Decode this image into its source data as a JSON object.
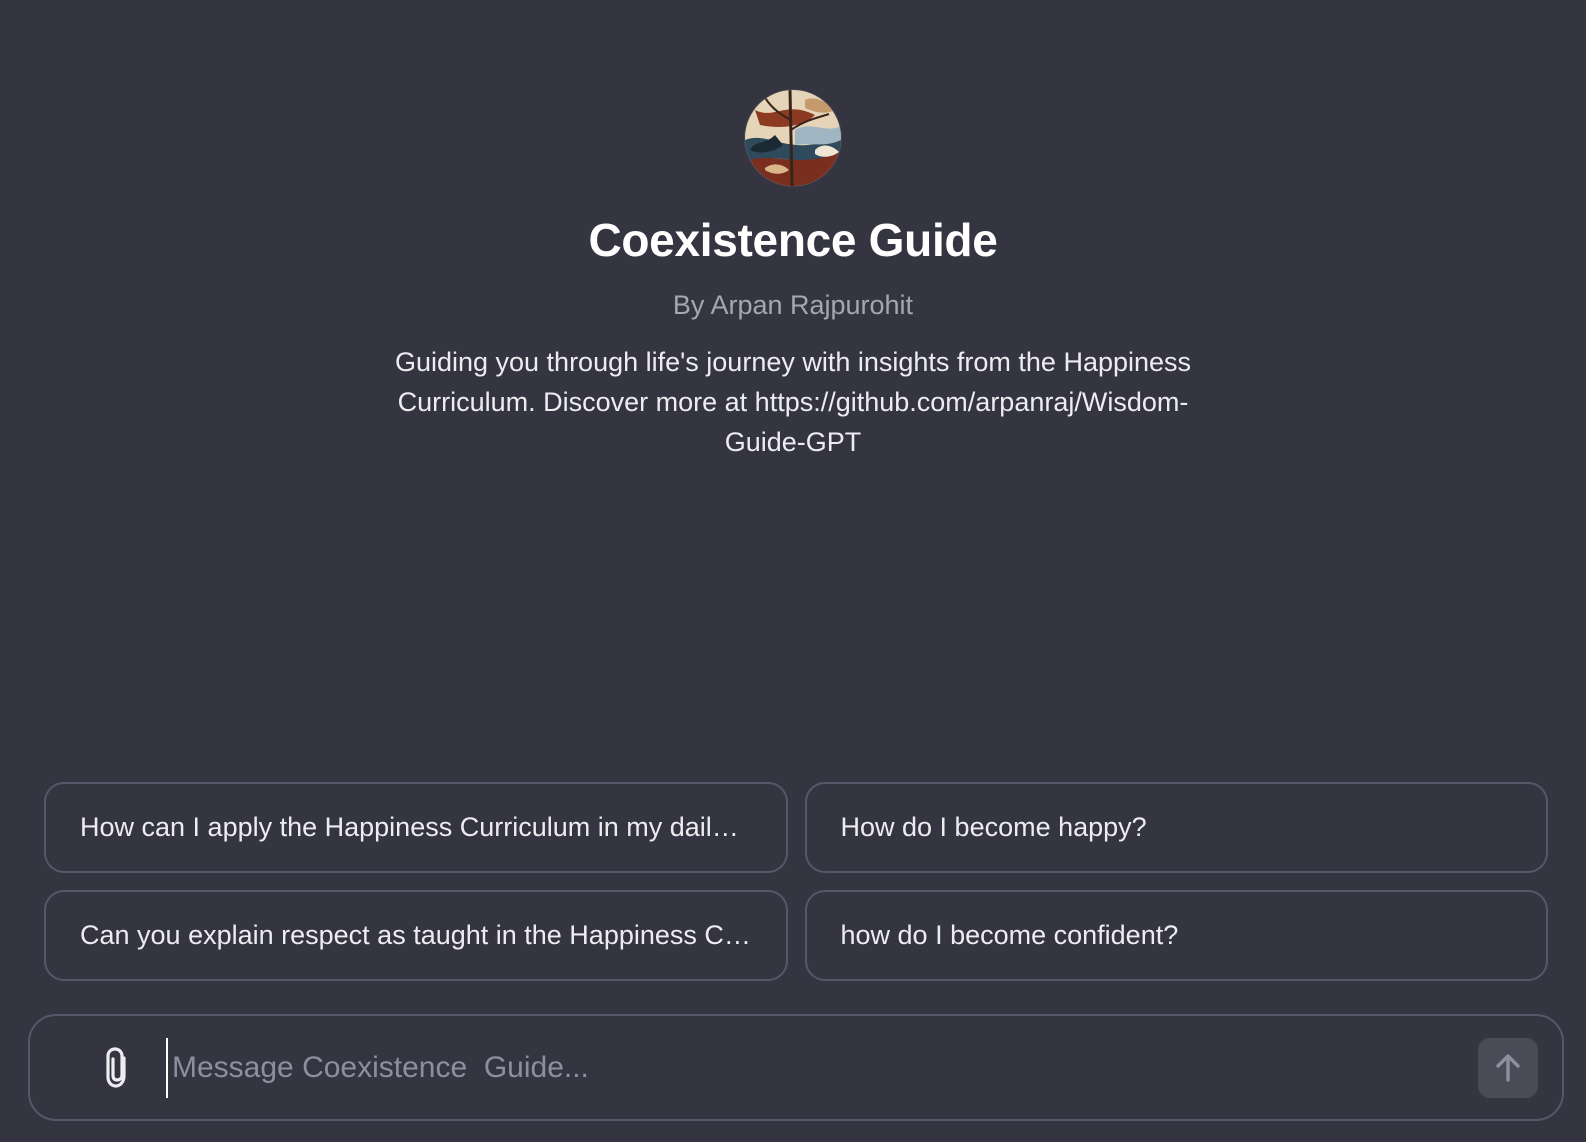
{
  "gpt": {
    "avatar_alt": "Coexistence Guide avatar",
    "title": "Coexistence Guide",
    "author": "By Arpan Rajpurohit",
    "description": "Guiding you through life's journey with insights from the Happiness Curriculum. Discover more at https://github.com/arpanraj/Wisdom-Guide-GPT"
  },
  "suggestions": [
    {
      "label": "How can I apply the Happiness Curriculum in my daily life?"
    },
    {
      "label": "How do I become happy?"
    },
    {
      "label": "Can you explain respect as taught in the Happiness Curriculum?"
    },
    {
      "label": "how do I become confident?"
    }
  ],
  "composer": {
    "placeholder": "Message Coexistence  Guide...",
    "attach_icon": "paperclip-icon",
    "send_icon": "arrow-up-icon"
  },
  "colors": {
    "background": "#343541",
    "border": "#565869",
    "text": "#ececf1",
    "muted": "#a6a6b2",
    "send_button": "#4a4b57"
  }
}
